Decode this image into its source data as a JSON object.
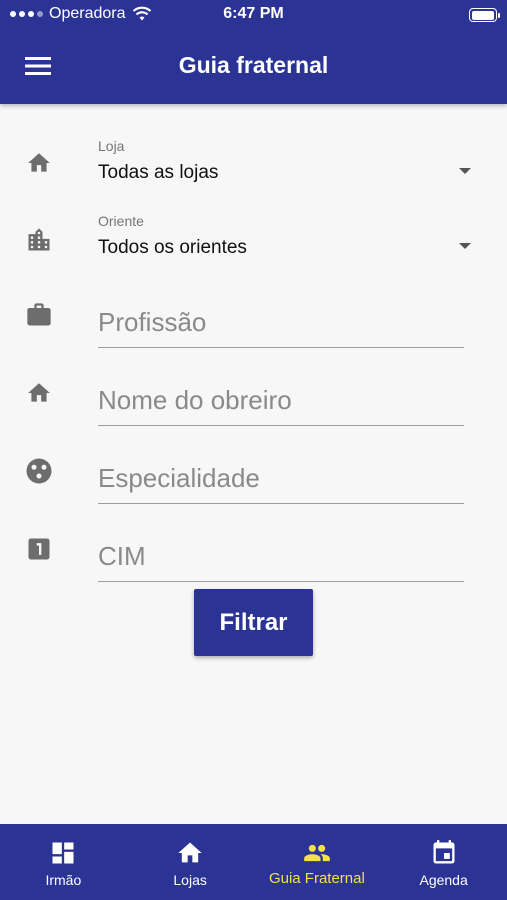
{
  "status_bar": {
    "carrier": "Operadora",
    "time": "6:47 PM"
  },
  "header": {
    "title": "Guia fraternal"
  },
  "form": {
    "loja": {
      "label": "Loja",
      "value": "Todas as lojas"
    },
    "oriente": {
      "label": "Oriente",
      "value": "Todos os orientes"
    },
    "profissao": {
      "placeholder": "Profissão"
    },
    "nome_obreiro": {
      "placeholder": "Nome do obreiro"
    },
    "especialidade": {
      "placeholder": "Especialidade"
    },
    "cim": {
      "placeholder": "CIM"
    },
    "filter_label": "Filtrar"
  },
  "bottom_nav": {
    "items": [
      {
        "label": "Irmão",
        "icon": "dashboard-icon"
      },
      {
        "label": "Lojas",
        "icon": "home-icon"
      },
      {
        "label": "Guia Fraternal",
        "icon": "people-icon",
        "active": true
      },
      {
        "label": "Agenda",
        "icon": "calendar-icon"
      }
    ]
  },
  "colors": {
    "primary": "#2b3494",
    "active_nav": "#f5e04a",
    "background": "#f7f7f7",
    "icon_gray": "#6d6d6d"
  }
}
